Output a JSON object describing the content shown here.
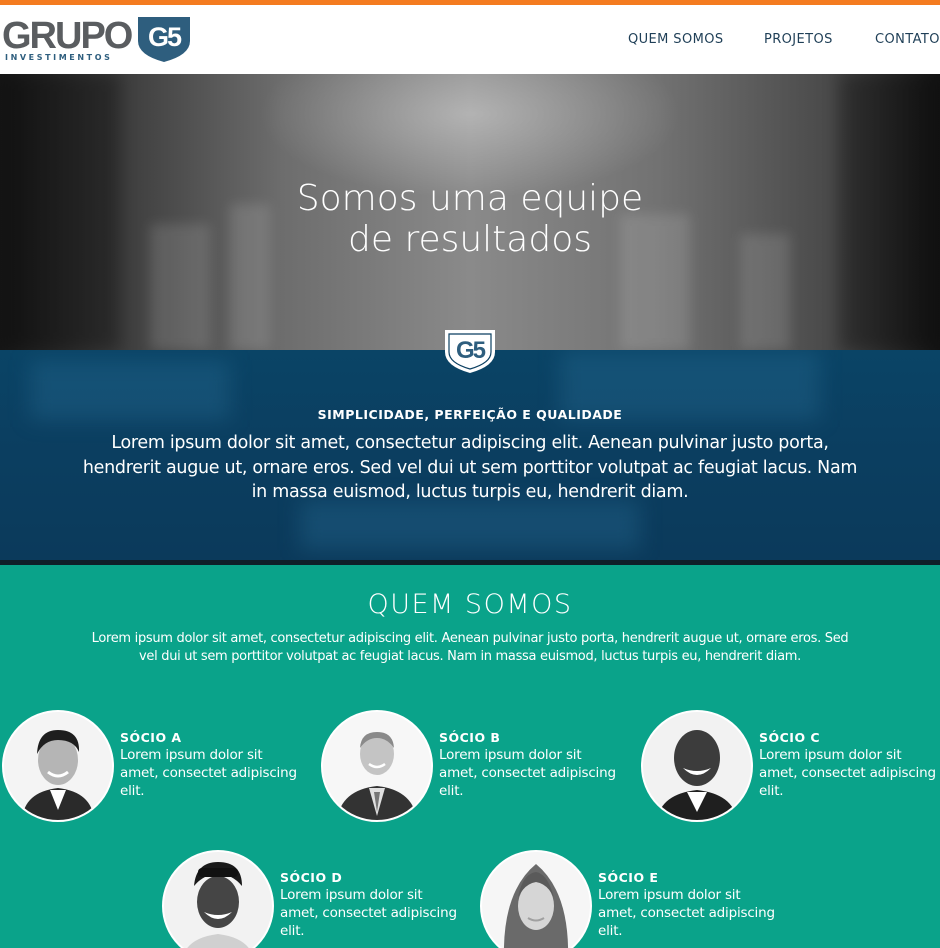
{
  "colors": {
    "accent_orange": "#f47b20",
    "navy": "#0b3f61",
    "teal": "#0aa38a",
    "logo_gray": "#5a5d60"
  },
  "logo": {
    "word": "GRUPO",
    "sub": "INVESTIMENTOS",
    "badge": "G5"
  },
  "nav": {
    "items": [
      "QUEM SOMOS",
      "PROJETOS",
      "CONTATO"
    ]
  },
  "hero": {
    "title_line1": "Somos uma equipe",
    "title_line2": "de resultados"
  },
  "band": {
    "badge": "G5",
    "heading": "SIMPLICIDADE, PERFEIÇÃO E QUALIDADE",
    "text": "Lorem ipsum dolor sit amet, consectetur adipiscing elit. Aenean pulvinar justo porta, hendrerit augue ut, ornare eros. Sed vel dui ut sem porttitor volutpat ac feugiat lacus. Nam in massa euismod, luctus turpis eu, hendrerit diam."
  },
  "team": {
    "title": "QUEM SOMOS",
    "intro": "Lorem ipsum dolor sit amet, consectetur adipiscing elit. Aenean pulvinar justo porta, hendrerit augue ut, ornare eros. Sed vel dui ut sem porttitor volutpat ac feugiat lacus. Nam in massa euismod, luctus turpis eu, hendrerit diam.",
    "members": [
      {
        "name": "SÓCIO A",
        "desc": "Lorem ipsum dolor sit amet, consectet adipiscing elit."
      },
      {
        "name": "SÓCIO B",
        "desc": "Lorem ipsum dolor sit amet, consectet adipiscing elit."
      },
      {
        "name": "SÓCIO C",
        "desc": "Lorem ipsum dolor sit amet, consectet adipiscing elit."
      },
      {
        "name": "SÓCIO D",
        "desc": "Lorem ipsum dolor sit amet, consectet adipiscing elit."
      },
      {
        "name": "SÓCIO E",
        "desc": "Lorem ipsum dolor sit amet, consectet adipiscing elit."
      }
    ]
  }
}
